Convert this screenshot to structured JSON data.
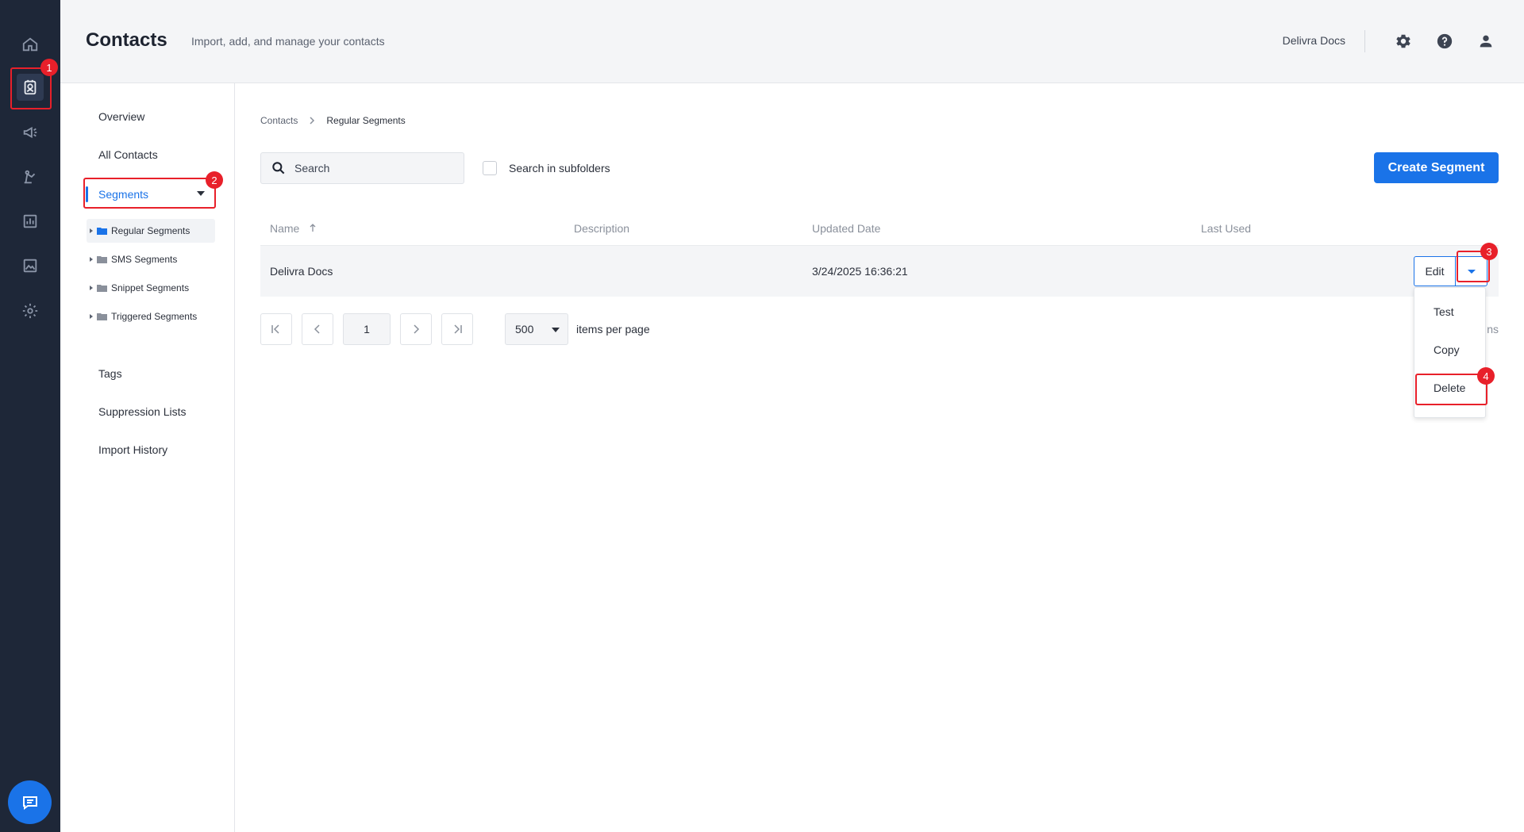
{
  "header": {
    "title": "Contacts",
    "subtitle": "Import, add, and manage your contacts",
    "account": "Delivra Docs"
  },
  "subnav": {
    "overview": "Overview",
    "all_contacts": "All Contacts",
    "segments": "Segments",
    "folders": [
      {
        "label": "Regular Segments"
      },
      {
        "label": "SMS Segments"
      },
      {
        "label": "Snippet Segments"
      },
      {
        "label": "Triggered Segments"
      }
    ],
    "tags": "Tags",
    "suppression": "Suppression Lists",
    "import_history": "Import History"
  },
  "breadcrumb": {
    "root": "Contacts",
    "current": "Regular Segments"
  },
  "toolbar": {
    "search_placeholder": "Search",
    "subfolders_label": "Search in subfolders",
    "create_label": "Create Segment"
  },
  "table": {
    "columns": {
      "name": "Name",
      "description": "Description",
      "updated": "Updated Date",
      "last_used": "Last Used"
    },
    "rows": [
      {
        "name": "Delivra Docs",
        "description": "",
        "updated": "3/24/2025 16:36:21",
        "last_used": ""
      }
    ],
    "edit_label": "Edit"
  },
  "pagination": {
    "page": "1",
    "per_page": "500",
    "per_page_label": "items per page",
    "count_text_fragment": "ns"
  },
  "row_menu": {
    "items": [
      "Test",
      "Copy",
      "Delete"
    ]
  },
  "annotations": [
    "1",
    "2",
    "3",
    "4"
  ],
  "colors": {
    "rail": "#1e2738",
    "accent": "#1a73e8",
    "annotation": "#e8202a"
  }
}
